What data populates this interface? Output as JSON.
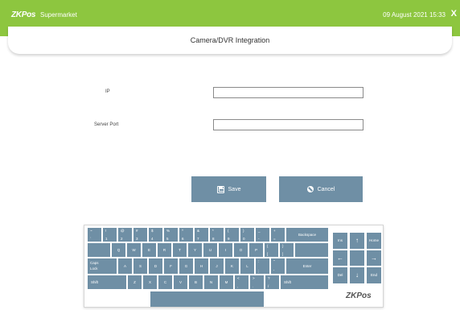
{
  "topbar": {
    "brand": "ZKPos",
    "store": "Supermarket",
    "datetime": "09 August 2021 15:33",
    "close_label": "X"
  },
  "page": {
    "title": "Camera/DVR Integration"
  },
  "form": {
    "ip_label": "IP",
    "ip_value": "",
    "port_label": "Server Port",
    "port_value": ""
  },
  "actions": {
    "save_label": "Save",
    "cancel_label": "Cancel"
  },
  "keyboard": {
    "logo": "ZKPos",
    "keys": {
      "r1_1_top": "~",
      "r1_1_bot": "`",
      "r1_2_top": "!",
      "r1_2_bot": "1",
      "r1_3_top": "@",
      "r1_3_bot": "2",
      "r1_4_top": "#",
      "r1_4_bot": "3",
      "r1_5_top": "$",
      "r1_5_bot": "4",
      "r1_6_top": "%",
      "r1_6_bot": "5",
      "r1_7_top": "^",
      "r1_7_bot": "6",
      "r1_8_top": "&",
      "r1_8_bot": "7",
      "r1_9_top": "*",
      "r1_9_bot": "8",
      "r1_10_top": "(",
      "r1_10_bot": "9",
      "r1_11_top": ")",
      "r1_11_bot": "0",
      "r1_12_top": "_",
      "r1_12_bot": "-",
      "r1_13_top": "+",
      "r1_13_bot": "=",
      "backspace": "Backspace",
      "q": "Q",
      "w": "W",
      "e": "E",
      "r": "R",
      "t": "T",
      "y": "Y",
      "u": "U",
      "i": "I",
      "o": "O",
      "p": "P",
      "lbrace_top": "{",
      "lbrace_bot": "[",
      "rbrace_top": "}",
      "rbrace_bot": "]",
      "caps_1": "Caps",
      "caps_2": "Lock",
      "a": "A",
      "s": "S",
      "d": "D",
      "f": "F",
      "g": "G",
      "h": "H",
      "j": "J",
      "k": "K",
      "l": "L",
      "colon_top": ":",
      "colon_bot": ";",
      "quote_top": "\"",
      "quote_bot": "'",
      "enter": "Enter",
      "shift": "Shift",
      "z": "Z",
      "x": "X",
      "c": "C",
      "v": "V",
      "b": "B",
      "n": "N",
      "m": "M",
      "lt_top": "<",
      "lt_bot": ",",
      "gt_top": ">",
      "gt_bot": ".",
      "q_top": "?",
      "q_bot": "/",
      "shift_r": "Shift",
      "ins": "Ins",
      "up": "↑",
      "home": "Home",
      "left": "←",
      "right": "→",
      "del": "Del",
      "down": "↓",
      "end": "End"
    }
  }
}
